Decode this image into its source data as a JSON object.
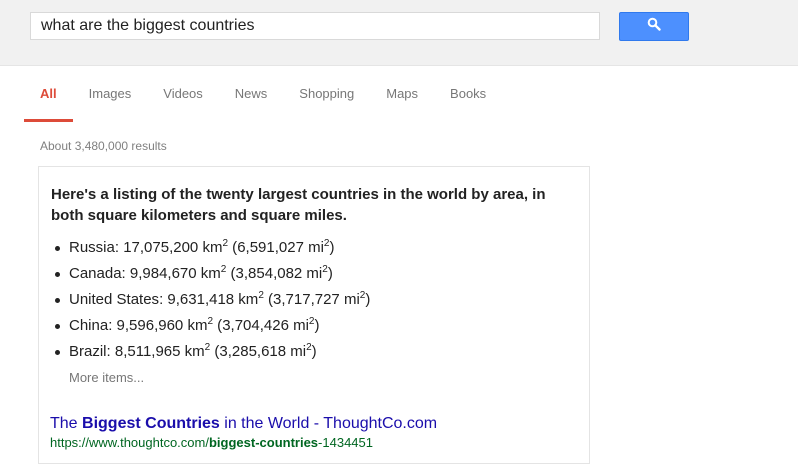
{
  "search": {
    "query": "what are the biggest countries",
    "button_icon": "search-icon"
  },
  "tabs": [
    {
      "label": "All",
      "active": true
    },
    {
      "label": "Images"
    },
    {
      "label": "Videos"
    },
    {
      "label": "News"
    },
    {
      "label": "Shopping"
    },
    {
      "label": "Maps"
    },
    {
      "label": "Books"
    }
  ],
  "results_count": "About 3,480,000 results",
  "snippet": {
    "heading": "Here's a listing of the twenty largest countries in the world by area, in both square kilometers and square miles.",
    "items": [
      {
        "country": "Russia",
        "km": "17,075,200 km",
        "mi": "6,591,027 mi"
      },
      {
        "country": "Canada",
        "km": "9,984,670 km",
        "mi": "3,854,082 mi"
      },
      {
        "country": "United States",
        "km": "9,631,418 km",
        "mi": "3,717,727 mi"
      },
      {
        "country": "China",
        "km": "9,596,960 km",
        "mi": "3,704,426 mi"
      },
      {
        "country": "Brazil",
        "km": "8,511,965 km",
        "mi": "3,285,618 mi"
      }
    ],
    "exponent": "2",
    "more_items": "More items...",
    "result": {
      "title_pre": "The ",
      "title_bold": "Biggest Countries",
      "title_post": " in the World - ThoughtCo.com",
      "url_pre": "https://www.thoughtco.com/",
      "url_bold": "biggest-countries",
      "url_post": "-1434451"
    }
  },
  "colors": {
    "accent": "#dd4b39",
    "button": "#4d90fe",
    "link": "#1a0dab",
    "url": "#006621"
  }
}
